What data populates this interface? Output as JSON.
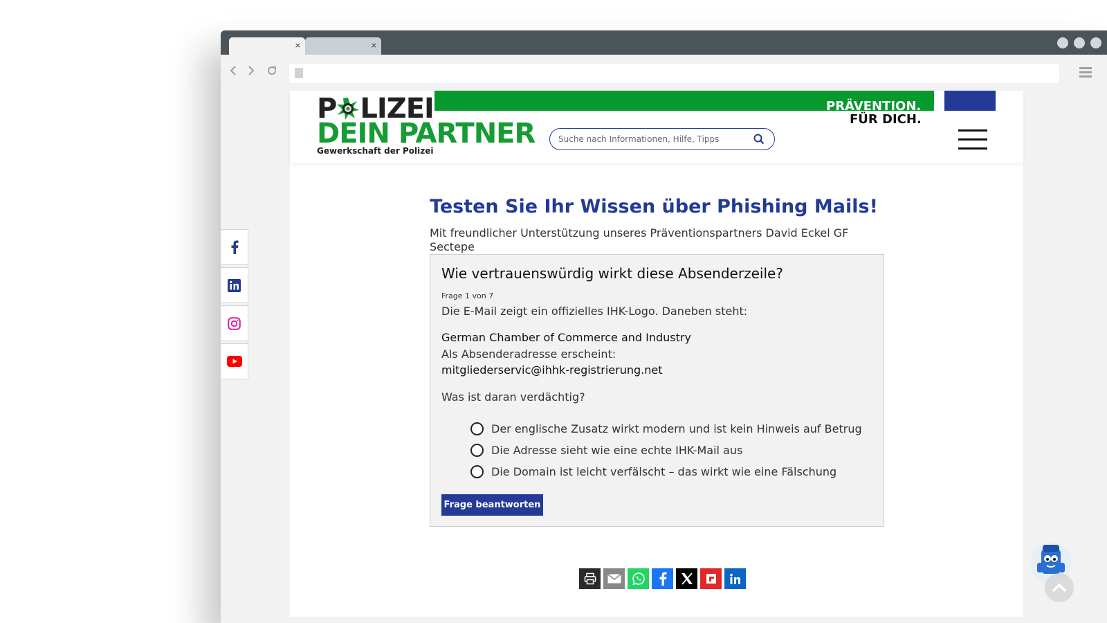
{
  "browser": {
    "tabs": [
      {
        "close": "×"
      },
      {
        "close": "×"
      }
    ],
    "url": ""
  },
  "header": {
    "logo_line1_a": "P",
    "logo_line1_b": "LIZEI",
    "logo_line2": "DEIN PARTNER",
    "logo_line3": "Gewerkschaft der Polizei",
    "slogan_1": "PRÄVENTION.",
    "slogan_2": "FÜR DICH.",
    "search_placeholder": "Suche nach Informationen, Hilfe, Tipps"
  },
  "main": {
    "title": "Testen Sie Ihr Wissen über Phishing Mails!",
    "subtitle": "Mit freundlicher Unterstützung unseres Präventionspartners David Eckel GF Sectepe"
  },
  "quiz": {
    "heading": "Wie vertrauenswürdig wirkt diese Absenderzeile?",
    "counter": "Frage 1 von 7",
    "text": "Die E-Mail zeigt ein offizielles IHK-Logo. Daneben steht:",
    "company": "German Chamber of Commerce and Industry",
    "sender_label": "Als Absenderadresse erscheint:",
    "sender_email": "mitgliederservic@ihhk-registrierung.net",
    "question": "Was ist daran verdächtig?",
    "options": [
      "Der englische Zusatz wirkt modern und ist kein Hinweis auf Betrug",
      "Die Adresse sieht wie eine echte IHK-Mail aus",
      "Die Domain ist leicht verfälscht – das wirkt wie eine Fälschung"
    ],
    "submit_label": "Frage beantworten"
  },
  "social_side": [
    "facebook-icon",
    "linkedin-icon",
    "instagram-icon",
    "youtube-icon"
  ],
  "share": [
    "print-icon",
    "email-icon",
    "whatsapp-icon",
    "facebook-icon",
    "x-icon",
    "flipboard-icon",
    "linkedin-icon"
  ],
  "colors": {
    "brand_blue": "#233a96",
    "brand_green": "#069a2e",
    "whatsapp": "#25d366",
    "facebook": "#1877f2",
    "flipboard": "#e12828",
    "linkedin": "#0a66c2",
    "youtube": "#ff0000"
  }
}
